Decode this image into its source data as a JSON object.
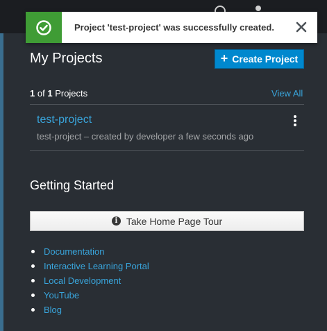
{
  "colors": {
    "background": "#292e34",
    "topbar": "#1b1d21",
    "accent": "#0088ce",
    "link": "#39a5dc",
    "success": "#3f9c35"
  },
  "toast": {
    "icon": "check-circle-icon",
    "message": "Project 'test-project' was successfully created.",
    "close_icon": "close-icon",
    "close_glyph": "✕"
  },
  "header": {
    "title": "My Projects",
    "create_button": {
      "icon": "plus-icon",
      "plus": "+",
      "label": "Create Project"
    }
  },
  "projects": {
    "count": {
      "current": "1",
      "of": "of",
      "total": "1",
      "noun": "Projects"
    },
    "view_all": "View All",
    "items": [
      {
        "name": "test-project",
        "description": "test-project – created by developer a few seconds ago",
        "menu_icon": "kebab-icon"
      }
    ]
  },
  "getting_started": {
    "title": "Getting Started",
    "tour_button": {
      "icon": "info-icon",
      "glyph": "i",
      "label": "Take Home Page Tour"
    },
    "links": [
      {
        "label": "Documentation"
      },
      {
        "label": "Interactive Learning Portal"
      },
      {
        "label": "Local Development"
      },
      {
        "label": "YouTube"
      },
      {
        "label": "Blog"
      }
    ]
  }
}
